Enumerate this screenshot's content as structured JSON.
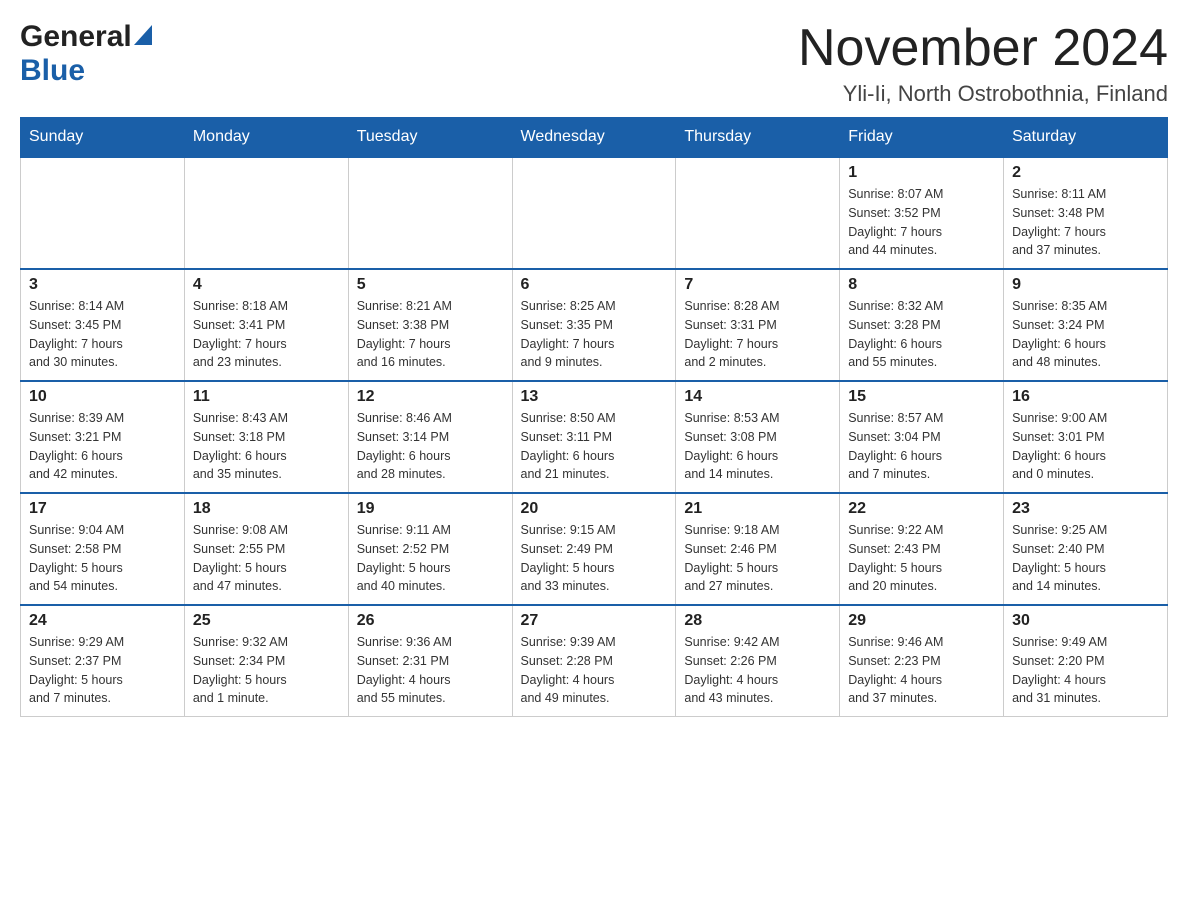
{
  "header": {
    "logo_general": "General",
    "logo_blue": "Blue",
    "month_title": "November 2024",
    "location": "Yli-Ii, North Ostrobothnia, Finland"
  },
  "weekdays": [
    "Sunday",
    "Monday",
    "Tuesday",
    "Wednesday",
    "Thursday",
    "Friday",
    "Saturday"
  ],
  "weeks": [
    [
      {
        "day": "",
        "info": ""
      },
      {
        "day": "",
        "info": ""
      },
      {
        "day": "",
        "info": ""
      },
      {
        "day": "",
        "info": ""
      },
      {
        "day": "",
        "info": ""
      },
      {
        "day": "1",
        "info": "Sunrise: 8:07 AM\nSunset: 3:52 PM\nDaylight: 7 hours\nand 44 minutes."
      },
      {
        "day": "2",
        "info": "Sunrise: 8:11 AM\nSunset: 3:48 PM\nDaylight: 7 hours\nand 37 minutes."
      }
    ],
    [
      {
        "day": "3",
        "info": "Sunrise: 8:14 AM\nSunset: 3:45 PM\nDaylight: 7 hours\nand 30 minutes."
      },
      {
        "day": "4",
        "info": "Sunrise: 8:18 AM\nSunset: 3:41 PM\nDaylight: 7 hours\nand 23 minutes."
      },
      {
        "day": "5",
        "info": "Sunrise: 8:21 AM\nSunset: 3:38 PM\nDaylight: 7 hours\nand 16 minutes."
      },
      {
        "day": "6",
        "info": "Sunrise: 8:25 AM\nSunset: 3:35 PM\nDaylight: 7 hours\nand 9 minutes."
      },
      {
        "day": "7",
        "info": "Sunrise: 8:28 AM\nSunset: 3:31 PM\nDaylight: 7 hours\nand 2 minutes."
      },
      {
        "day": "8",
        "info": "Sunrise: 8:32 AM\nSunset: 3:28 PM\nDaylight: 6 hours\nand 55 minutes."
      },
      {
        "day": "9",
        "info": "Sunrise: 8:35 AM\nSunset: 3:24 PM\nDaylight: 6 hours\nand 48 minutes."
      }
    ],
    [
      {
        "day": "10",
        "info": "Sunrise: 8:39 AM\nSunset: 3:21 PM\nDaylight: 6 hours\nand 42 minutes."
      },
      {
        "day": "11",
        "info": "Sunrise: 8:43 AM\nSunset: 3:18 PM\nDaylight: 6 hours\nand 35 minutes."
      },
      {
        "day": "12",
        "info": "Sunrise: 8:46 AM\nSunset: 3:14 PM\nDaylight: 6 hours\nand 28 minutes."
      },
      {
        "day": "13",
        "info": "Sunrise: 8:50 AM\nSunset: 3:11 PM\nDaylight: 6 hours\nand 21 minutes."
      },
      {
        "day": "14",
        "info": "Sunrise: 8:53 AM\nSunset: 3:08 PM\nDaylight: 6 hours\nand 14 minutes."
      },
      {
        "day": "15",
        "info": "Sunrise: 8:57 AM\nSunset: 3:04 PM\nDaylight: 6 hours\nand 7 minutes."
      },
      {
        "day": "16",
        "info": "Sunrise: 9:00 AM\nSunset: 3:01 PM\nDaylight: 6 hours\nand 0 minutes."
      }
    ],
    [
      {
        "day": "17",
        "info": "Sunrise: 9:04 AM\nSunset: 2:58 PM\nDaylight: 5 hours\nand 54 minutes."
      },
      {
        "day": "18",
        "info": "Sunrise: 9:08 AM\nSunset: 2:55 PM\nDaylight: 5 hours\nand 47 minutes."
      },
      {
        "day": "19",
        "info": "Sunrise: 9:11 AM\nSunset: 2:52 PM\nDaylight: 5 hours\nand 40 minutes."
      },
      {
        "day": "20",
        "info": "Sunrise: 9:15 AM\nSunset: 2:49 PM\nDaylight: 5 hours\nand 33 minutes."
      },
      {
        "day": "21",
        "info": "Sunrise: 9:18 AM\nSunset: 2:46 PM\nDaylight: 5 hours\nand 27 minutes."
      },
      {
        "day": "22",
        "info": "Sunrise: 9:22 AM\nSunset: 2:43 PM\nDaylight: 5 hours\nand 20 minutes."
      },
      {
        "day": "23",
        "info": "Sunrise: 9:25 AM\nSunset: 2:40 PM\nDaylight: 5 hours\nand 14 minutes."
      }
    ],
    [
      {
        "day": "24",
        "info": "Sunrise: 9:29 AM\nSunset: 2:37 PM\nDaylight: 5 hours\nand 7 minutes."
      },
      {
        "day": "25",
        "info": "Sunrise: 9:32 AM\nSunset: 2:34 PM\nDaylight: 5 hours\nand 1 minute."
      },
      {
        "day": "26",
        "info": "Sunrise: 9:36 AM\nSunset: 2:31 PM\nDaylight: 4 hours\nand 55 minutes."
      },
      {
        "day": "27",
        "info": "Sunrise: 9:39 AM\nSunset: 2:28 PM\nDaylight: 4 hours\nand 49 minutes."
      },
      {
        "day": "28",
        "info": "Sunrise: 9:42 AM\nSunset: 2:26 PM\nDaylight: 4 hours\nand 43 minutes."
      },
      {
        "day": "29",
        "info": "Sunrise: 9:46 AM\nSunset: 2:23 PM\nDaylight: 4 hours\nand 37 minutes."
      },
      {
        "day": "30",
        "info": "Sunrise: 9:49 AM\nSunset: 2:20 PM\nDaylight: 4 hours\nand 31 minutes."
      }
    ]
  ]
}
